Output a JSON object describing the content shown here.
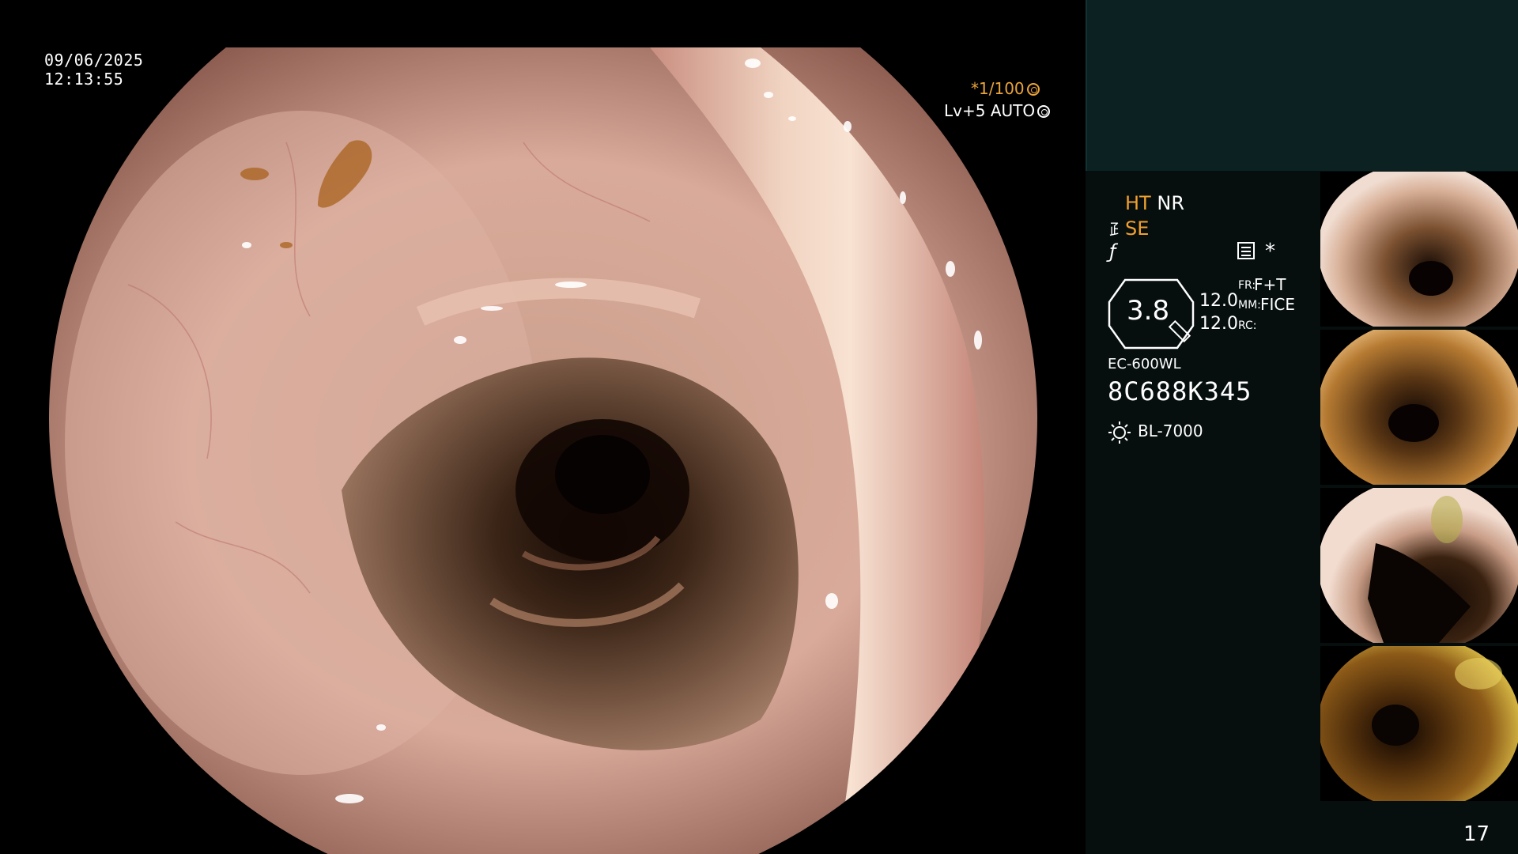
{
  "overlay": {
    "date": "09/06/2025",
    "time": "12:13:55",
    "shutter": "*1/100",
    "level": "Lv+5 AUTO"
  },
  "panel": {
    "ht": "HT",
    "nr": "NR",
    "se": "SE",
    "zoom_value": "3.8",
    "value_a": "12.0",
    "value_b": "12.0",
    "fr_label": "FR:",
    "fr_value": "F+T",
    "mm_label": "MM:",
    "mm_value": "FICE",
    "rc_label": "RC:",
    "scope_model": "EC-600WL",
    "scope_serial": "8C688K345",
    "light_source": "BL-7000",
    "page_number": "17"
  },
  "colors": {
    "accent": "#f0a030",
    "panel_background": "#060e0e",
    "panel_top": "#0c2222"
  },
  "icons": [
    "shutter-icon",
    "auto-iris-icon",
    "fiber-icon",
    "freeze-icon",
    "memo-icon",
    "zoom-icon",
    "light-source-icon"
  ],
  "thumbnails": [
    {
      "label": "thumbnail-1"
    },
    {
      "label": "thumbnail-2"
    },
    {
      "label": "thumbnail-3"
    },
    {
      "label": "thumbnail-4"
    }
  ]
}
